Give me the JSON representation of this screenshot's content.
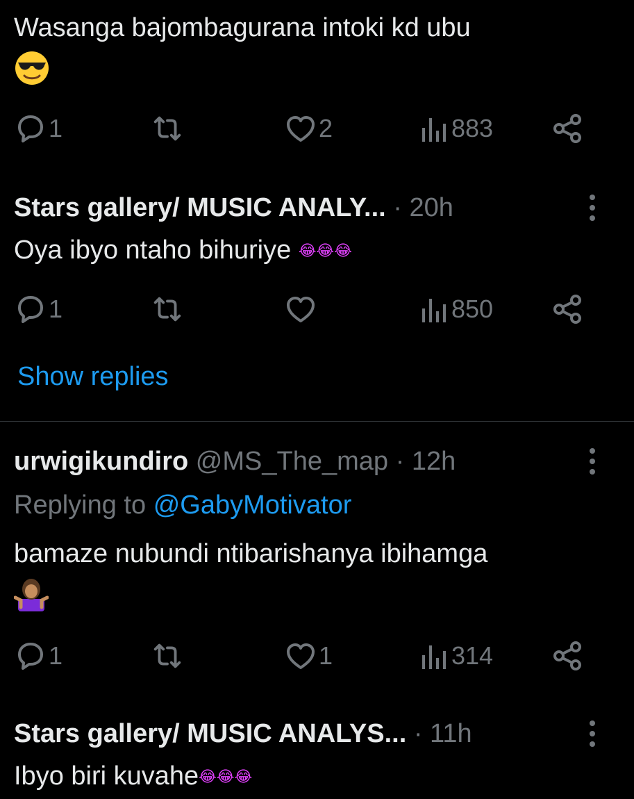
{
  "tweets": [
    {
      "text": "Wasanga bajombagurana intoki kd ubu",
      "emoji": "smiling-face-with-sunglasses",
      "actions": {
        "reply_count": "1",
        "retweet_count": "",
        "like_count": "2",
        "view_count": "883"
      }
    },
    {
      "name": "Stars gallery/ MUSIC ANALY...",
      "separator": "·",
      "time": "20h",
      "text": "Oya ibyo ntaho bihuriye",
      "emoji_text": "😂😂😂",
      "actions": {
        "reply_count": "1",
        "retweet_count": "",
        "like_count": "",
        "view_count": "850"
      },
      "show_replies": "Show replies"
    },
    {
      "name": "urwigikundiro",
      "handle": "@MS_The_map",
      "separator": "·",
      "time": "12h",
      "replying_prefix": "Replying to",
      "replying_handle": "@GabyMotivator",
      "text": "bamaze nubundi ntibarishanya ibihamga",
      "emoji": "person-shrugging",
      "actions": {
        "reply_count": "1",
        "retweet_count": "",
        "like_count": "1",
        "view_count": "314"
      }
    },
    {
      "name": "Stars gallery/ MUSIC ANALYS...",
      "separator": "·",
      "time": "11h",
      "text": "Ibyo biri kuvahe",
      "emoji_text": "😂😂😂"
    }
  ],
  "icons": {
    "reply": "reply-icon",
    "retweet": "retweet-icon",
    "like": "heart-icon",
    "views": "views-icon",
    "share": "share-icon",
    "more": "more-icon"
  },
  "colors": {
    "background": "#000000",
    "text": "#e7e9ea",
    "muted": "#71767b",
    "accent": "#1d9bf0",
    "divider": "#2f3336",
    "laugh_emoji": "#e040fb"
  }
}
